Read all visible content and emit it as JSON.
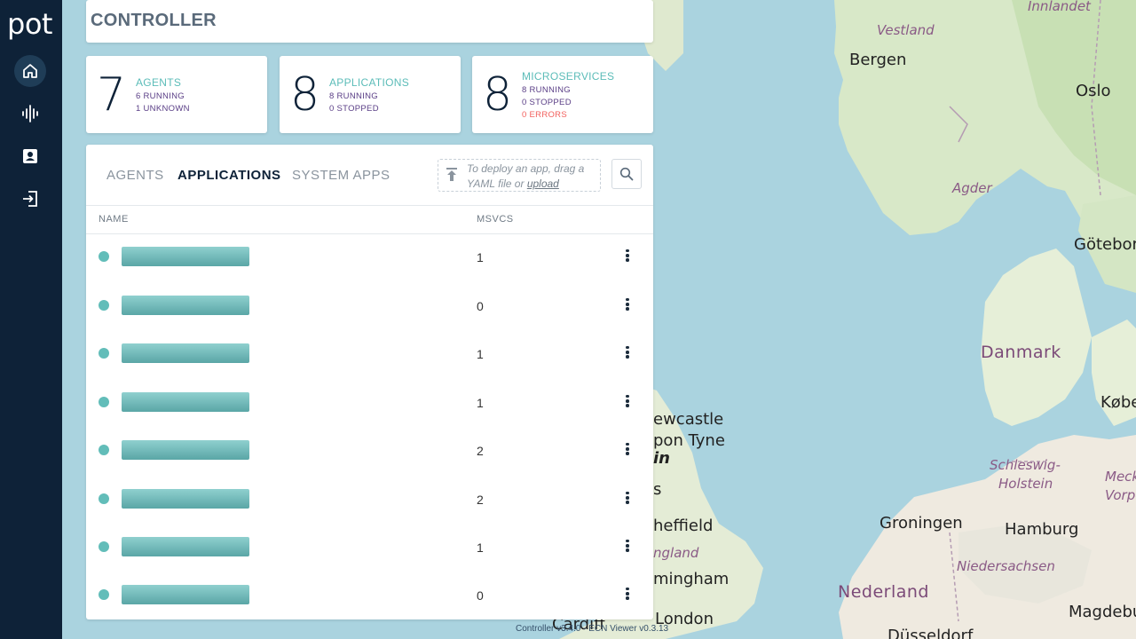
{
  "brand": {
    "logo_text": "pot"
  },
  "sidebar": {
    "items": [
      {
        "name": "home",
        "icon": "home-icon",
        "active": true
      },
      {
        "name": "activity",
        "icon": "waveform-icon",
        "active": false
      },
      {
        "name": "catalog",
        "icon": "contact-card-icon",
        "active": false
      },
      {
        "name": "logout",
        "icon": "logout-icon",
        "active": false
      }
    ]
  },
  "header": {
    "title": "CONTROLLER"
  },
  "stats": {
    "agents": {
      "count": "7",
      "label": "AGENTS",
      "lines": [
        "6 RUNNING",
        "1 UNKNOWN"
      ]
    },
    "applications": {
      "count": "8",
      "label": "APPLICATIONS",
      "lines": [
        "8 RUNNING",
        "0 STOPPED"
      ]
    },
    "microservices": {
      "count": "8",
      "label": "MICROSERVICES",
      "lines": [
        "8 RUNNING",
        "0 STOPPED"
      ],
      "error_line": "0 ERRORS"
    }
  },
  "tabs": [
    {
      "label": "AGENTS",
      "active": false
    },
    {
      "label": "APPLICATIONS",
      "active": true
    },
    {
      "label": "SYSTEM APPS",
      "active": false
    }
  ],
  "upload": {
    "text": "To deploy an app, drag a YAML file or ",
    "link": "upload"
  },
  "table": {
    "columns": [
      "NAME",
      "MSVCS"
    ],
    "rows": [
      {
        "status": "running",
        "msvcs": "1"
      },
      {
        "status": "running",
        "msvcs": "0"
      },
      {
        "status": "running",
        "msvcs": "1"
      },
      {
        "status": "running",
        "msvcs": "1"
      },
      {
        "status": "running",
        "msvcs": "2"
      },
      {
        "status": "running",
        "msvcs": "2"
      },
      {
        "status": "running",
        "msvcs": "1"
      },
      {
        "status": "running",
        "msvcs": "0"
      }
    ]
  },
  "footer": {
    "version": "Controller v3.4.0 - ECN Viewer v0.3.13"
  },
  "map": {
    "labels": {
      "innlandet": "Innlandet",
      "vestland": "Vestland",
      "bergen": "Bergen",
      "oslo": "Oslo",
      "agder": "Agder",
      "goteborg": "Götebor",
      "danmark": "Danmark",
      "kobenhavn": "Køber",
      "newcastle1": "ewcastle",
      "newcastle2": "pon Tyne",
      "schleswig1": "Schleswig-",
      "schleswig2": "Holstein",
      "meckle1": "Meckle",
      "meckle2": "Vorpor",
      "sheffield": "heffield",
      "groningen": "Groningen",
      "hamburg": "Hamburg",
      "england": "ngland",
      "niedersachsen": "Niedersachsen",
      "birmingham": "mingham",
      "nederland": "Nederland",
      "magdeburg": "Magdebur",
      "london": "London",
      "cardiff": "Cardiff",
      "dusseldorf": "Düsseldorf",
      "frag_in": "in",
      "frag_s": "s"
    }
  },
  "colors": {
    "sidebar": "#0e2238",
    "accent": "#5bbcb8",
    "purple": "#5a3e86",
    "error": "#f25f5c",
    "water": "#aad3df",
    "land": "#f2efe9",
    "forest": "#cfe6bf"
  }
}
